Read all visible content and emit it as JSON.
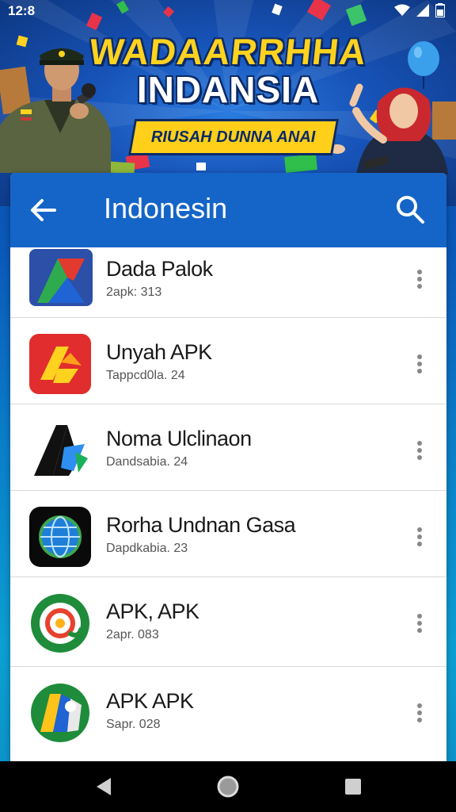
{
  "status_bar": {
    "time": "12:8",
    "icons": [
      "wifi-icon",
      "signal-icon",
      "battery-icon"
    ]
  },
  "banner": {
    "title_line1": "WADAARRHHA",
    "title_line2": "INDANSIA",
    "ribbon_text": "RIUSAH DUNNA ANAI"
  },
  "app_bar": {
    "title": "Indonesin",
    "back_icon": "arrow-left-icon",
    "search_icon": "search-icon",
    "color": "#1565c8"
  },
  "apps": [
    {
      "name": "Dada Palok",
      "meta": "2apk: 313",
      "icon": "google-drive-style-icon"
    },
    {
      "name": "Unyah APK",
      "meta": "Tappcd0la. 24",
      "icon": "red-arrow-app-icon"
    },
    {
      "name": "Noma Ulclinaon",
      "meta": "Dandsabia. 24",
      "icon": "black-a-logo-icon"
    },
    {
      "name": "Rorha Undnan Gasa",
      "meta": "Dapdkabia. 23",
      "icon": "globe-app-icon"
    },
    {
      "name": "APK, APK",
      "meta": "2apr. 083",
      "icon": "green-circle-app-icon"
    },
    {
      "name": "APK APK",
      "meta": "Sapr. 028",
      "icon": "maps-style-app-icon"
    }
  ],
  "nav_bar": {
    "buttons": [
      "back-triangle-icon",
      "home-circle-icon",
      "recents-square-icon"
    ]
  }
}
